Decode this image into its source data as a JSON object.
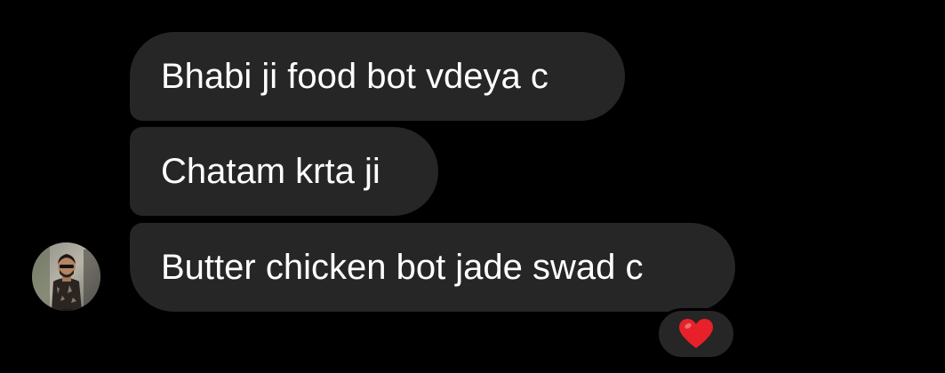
{
  "conversation": {
    "messages": [
      {
        "text": "Bhabi ji food bot vdeya c"
      },
      {
        "text": "Chatam krta ji"
      },
      {
        "text": "Butter chicken bot jade swad c",
        "reaction": "red-heart"
      }
    ],
    "sender": {
      "avatar": "profile-photo"
    }
  },
  "colors": {
    "background": "#000000",
    "bubble": "#262626",
    "text": "#ffffff",
    "reaction_heart": "#e8202a"
  }
}
